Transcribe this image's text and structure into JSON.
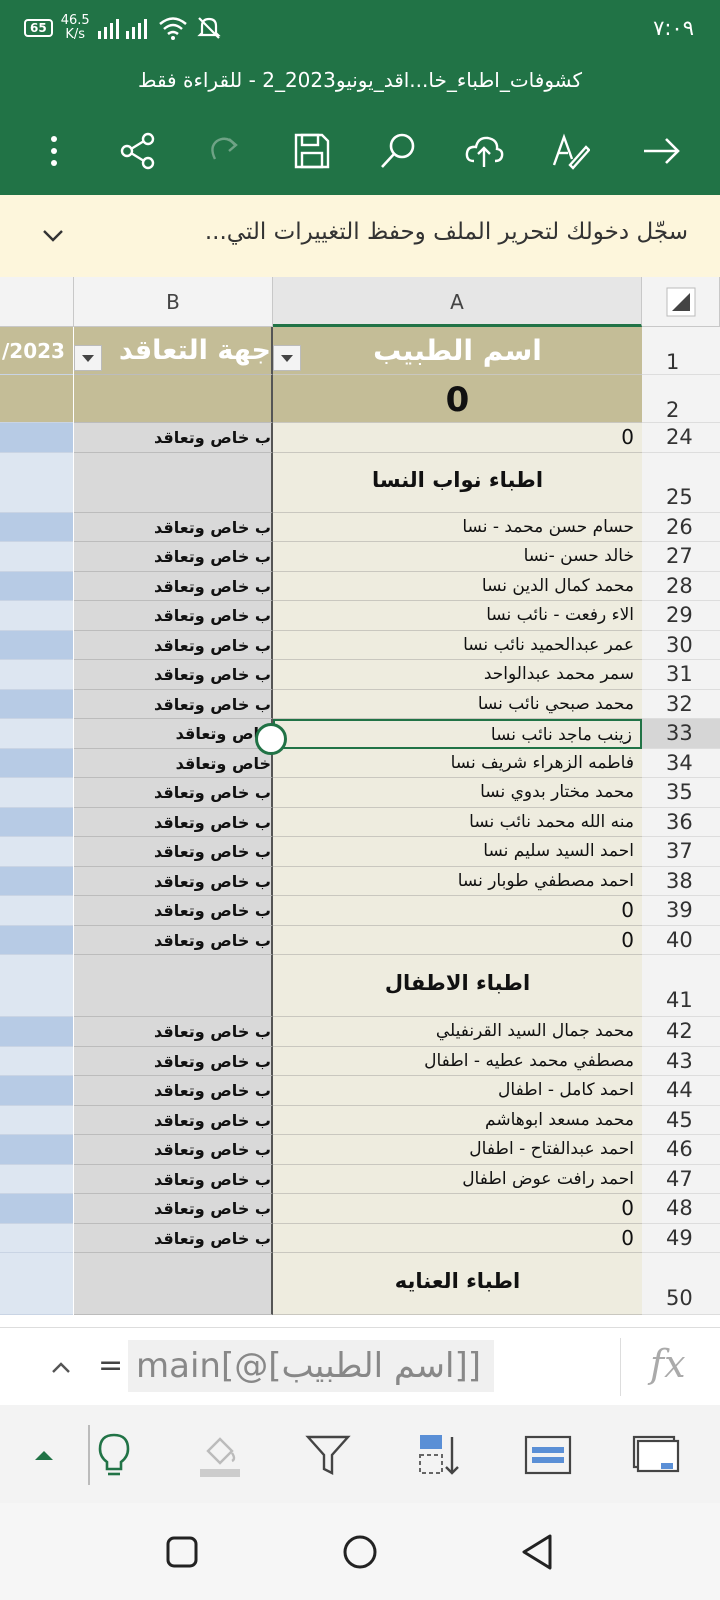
{
  "status_bar": {
    "time": "٧:٠٩",
    "battery": "65",
    "net_speed_value": "46.5",
    "net_speed_unit": "K/s"
  },
  "document_title": "كشوفات_اطباء_خا...اقد_يونيو2023_2 - للقراءة فقط",
  "toolbar_icons": [
    "more-icon",
    "share-icon",
    "redo-icon",
    "save-icon",
    "search-icon",
    "cloud-upload-icon",
    "edit-draw-icon",
    "forward-arrow-icon"
  ],
  "banner": {
    "text": "سجّل دخولك لتحرير الملف وحفظ التغييرات التي..."
  },
  "grid": {
    "column_headers": {
      "A": "A",
      "B": "B"
    },
    "header_row": {
      "num": "1",
      "col_a": "اسم الطبيب",
      "col_b": "جهة التعاقد",
      "col_c": "/2023"
    },
    "row2": {
      "num": "2",
      "col_a": "0"
    },
    "rows": [
      {
        "num": "24",
        "name": "0",
        "b": "ب خاص وتعاقد"
      },
      {
        "num": "25",
        "name": "اطباء نواب النسا",
        "b": "",
        "section": true
      },
      {
        "num": "26",
        "name": "حسام حسن محمد - نسا",
        "b": "ب خاص وتعاقد"
      },
      {
        "num": "27",
        "name": "خالد حسن -نسا",
        "b": "ب خاص وتعاقد"
      },
      {
        "num": "28",
        "name": "محمد كمال الدين نسا",
        "b": "ب خاص وتعاقد"
      },
      {
        "num": "29",
        "name": "الاء رفعت - نائب نسا",
        "b": "ب خاص وتعاقد"
      },
      {
        "num": "30",
        "name": "عمر عبدالحميد نائب نسا",
        "b": "ب خاص وتعاقد"
      },
      {
        "num": "31",
        "name": "سمر محمد عبدالواحد",
        "b": "ب خاص وتعاقد"
      },
      {
        "num": "32",
        "name": "محمد صبحي نائب نسا",
        "b": "ب خاص وتعاقد"
      },
      {
        "num": "33",
        "name": "زينب ماجد نائب نسا",
        "b": "خاص وتعاقد",
        "selected": true
      },
      {
        "num": "34",
        "name": "فاطمه الزهراء شريف نسا",
        "b": "خاص وتعاقد"
      },
      {
        "num": "35",
        "name": "محمد مختار بدوي نسا",
        "b": "ب خاص وتعاقد"
      },
      {
        "num": "36",
        "name": "منه الله محمد نائب نسا",
        "b": "ب خاص وتعاقد"
      },
      {
        "num": "37",
        "name": "احمد السيد سليم نسا",
        "b": "ب خاص وتعاقد"
      },
      {
        "num": "38",
        "name": "احمد مصطفي طوبار نسا",
        "b": "ب خاص وتعاقد"
      },
      {
        "num": "39",
        "name": "0",
        "b": "ب خاص وتعاقد"
      },
      {
        "num": "40",
        "name": "0",
        "b": "ب خاص وتعاقد"
      },
      {
        "num": "41",
        "name": "اطباء الاطفال",
        "b": "",
        "section": true
      },
      {
        "num": "42",
        "name": "محمد جمال السيد القرنفيلي",
        "b": "ب خاص وتعاقد"
      },
      {
        "num": "43",
        "name": "مصطفي محمد عطيه - اطفال",
        "b": "ب خاص وتعاقد"
      },
      {
        "num": "44",
        "name": "احمد كامل - اطفال",
        "b": "ب خاص وتعاقد"
      },
      {
        "num": "45",
        "name": "محمد مسعد ابوهاشم",
        "b": "ب خاص وتعاقد"
      },
      {
        "num": "46",
        "name": "احمد عبدالفتاح - اطفال",
        "b": "ب خاص وتعاقد"
      },
      {
        "num": "47",
        "name": "احمد رافت عوض اطفال",
        "b": "ب خاص وتعاقد"
      },
      {
        "num": "48",
        "name": "0",
        "b": "ب خاص وتعاقد"
      },
      {
        "num": "49",
        "name": "0",
        "b": "ب خاص وتعاقد"
      },
      {
        "num": "50",
        "name": "اطباء العنايه",
        "b": "",
        "section": true
      }
    ]
  },
  "formula_bar": {
    "equals": "=",
    "formula": "main[@[اسم الطبيب]]",
    "fx": "fx"
  },
  "bottom_toolbar_icons": [
    "expand-up-icon",
    "ideas-bulb-icon",
    "fill-color-icon",
    "filter-icon",
    "sort-icon",
    "wrap-text-icon",
    "freeze-panes-icon"
  ],
  "nav_icons": [
    "recent-apps-icon",
    "home-icon",
    "back-icon"
  ],
  "colors": {
    "excel_green": "#217346",
    "banner_bg": "#fdf6dc",
    "header_fill": "#c4bd97",
    "name_fill": "#eeecdf",
    "blue_fill_dark": "#b7cbe5",
    "blue_fill_light": "#dde6f1"
  }
}
